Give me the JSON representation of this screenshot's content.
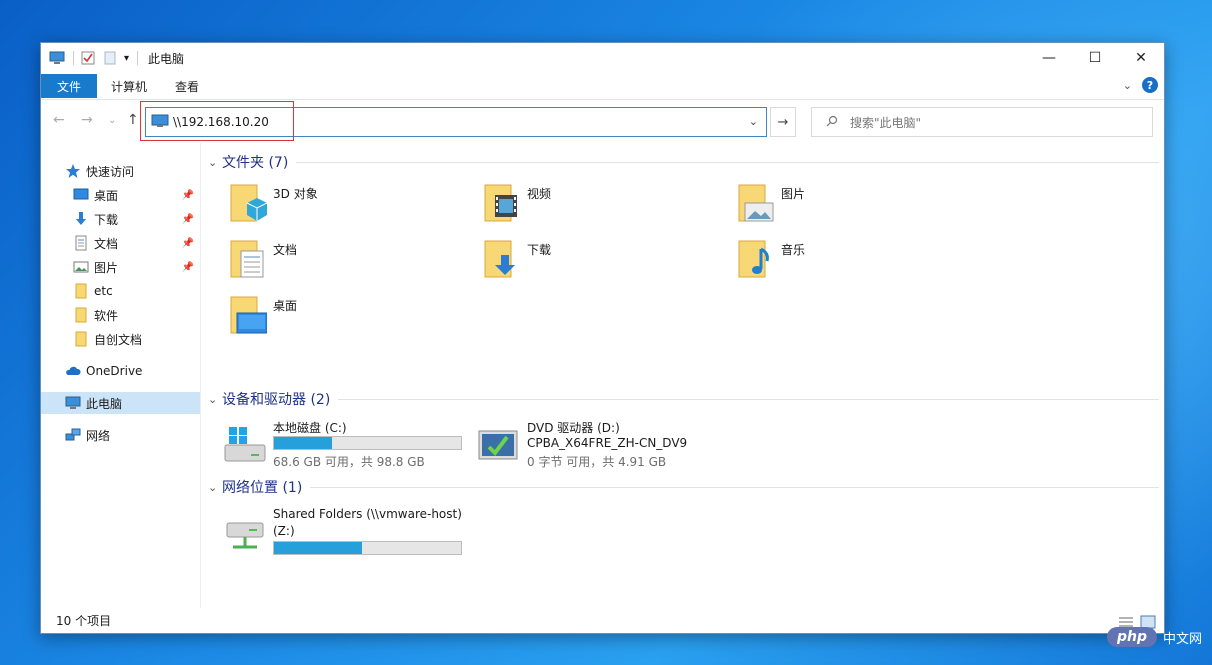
{
  "window": {
    "title": "此电脑",
    "controls": {
      "minimize": "—",
      "maximize": "☐",
      "close": "✕"
    }
  },
  "ribbon": {
    "tabs": [
      "文件",
      "计算机",
      "查看"
    ]
  },
  "navbar": {
    "address": "\\\\192.168.10.20",
    "search_placeholder": "搜索\"此电脑\""
  },
  "sidebar": {
    "items": [
      {
        "label": "快速访问",
        "icon": "star-icon"
      },
      {
        "label": "桌面",
        "icon": "desktop-icon",
        "pinned": true
      },
      {
        "label": "下载",
        "icon": "download-icon",
        "pinned": true
      },
      {
        "label": "文档",
        "icon": "document-icon",
        "pinned": true
      },
      {
        "label": "图片",
        "icon": "picture-icon",
        "pinned": true
      },
      {
        "label": "etc",
        "icon": "folder-icon"
      },
      {
        "label": "软件",
        "icon": "folder-icon"
      },
      {
        "label": "自创文档",
        "icon": "folder-icon"
      },
      {
        "label": "OneDrive",
        "icon": "cloud-icon"
      },
      {
        "label": "此电脑",
        "icon": "computer-icon",
        "selected": true
      },
      {
        "label": "网络",
        "icon": "network-icon"
      }
    ]
  },
  "sections": {
    "folders": {
      "title": "文件夹 (7)"
    },
    "drives": {
      "title": "设备和驱动器 (2)"
    },
    "network": {
      "title": "网络位置 (1)"
    }
  },
  "folders": [
    {
      "label": "3D 对象",
      "icon": "3d-objects-icon"
    },
    {
      "label": "视频",
      "icon": "video-folder-icon"
    },
    {
      "label": "图片",
      "icon": "pictures-folder-icon"
    },
    {
      "label": "文档",
      "icon": "documents-folder-icon"
    },
    {
      "label": "下载",
      "icon": "downloads-folder-icon"
    },
    {
      "label": "音乐",
      "icon": "music-folder-icon"
    },
    {
      "label": "桌面",
      "icon": "desktop-folder-icon"
    }
  ],
  "drives": [
    {
      "name": "本地磁盘 (C:)",
      "detail": "68.6 GB 可用，共 98.8 GB",
      "used_fraction": 0.31,
      "icon": "windows-drive-icon"
    },
    {
      "name": "DVD 驱动器 (D:)",
      "name2": "CPBA_X64FRE_ZH-CN_DV9",
      "detail": "0 字节 可用，共 4.91 GB",
      "icon": "dvd-drive-icon"
    }
  ],
  "network_locations": [
    {
      "name": "Shared Folders (\\\\vmware-host)",
      "name2": "(Z:)",
      "used_fraction": 0.47,
      "icon": "network-drive-icon"
    }
  ],
  "status": {
    "count": "10 个项目"
  },
  "watermark": {
    "badge": "php",
    "text": "中文网"
  },
  "colors": {
    "accent": "#1979ca",
    "bar": "#26a0da",
    "section_title": "#1e3287",
    "selected": "#cce4f7"
  }
}
